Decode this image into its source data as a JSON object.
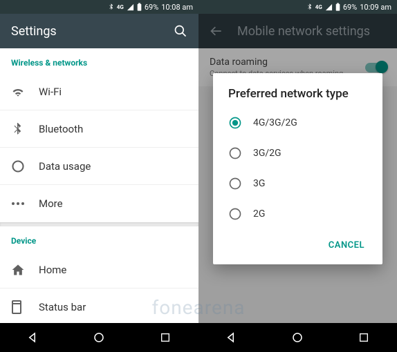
{
  "left": {
    "status": {
      "signal": "4G",
      "battery": "69%",
      "time": "10:08 am"
    },
    "title": "Settings",
    "section1": "Wireless & networks",
    "items1": [
      {
        "icon": "wifi",
        "label": "Wi-Fi"
      },
      {
        "icon": "bluetooth",
        "label": "Bluetooth"
      },
      {
        "icon": "data",
        "label": "Data usage"
      },
      {
        "icon": "more",
        "label": "More"
      }
    ],
    "section2": "Device",
    "items2": [
      {
        "icon": "home",
        "label": "Home"
      },
      {
        "icon": "statusbar",
        "label": "Status bar"
      }
    ]
  },
  "right": {
    "status": {
      "signal": "4G",
      "battery": "69%",
      "time": "10:09 am"
    },
    "title": "Mobile network settings",
    "roaming": {
      "title": "Data roaming",
      "subtitle": "Connect to data services when roaming"
    },
    "dialog": {
      "title": "Preferred network type",
      "options": [
        "4G/3G/2G",
        "3G/2G",
        "3G",
        "2G"
      ],
      "selected": 0,
      "cancel": "CANCEL"
    }
  },
  "watermark": "fonearena"
}
